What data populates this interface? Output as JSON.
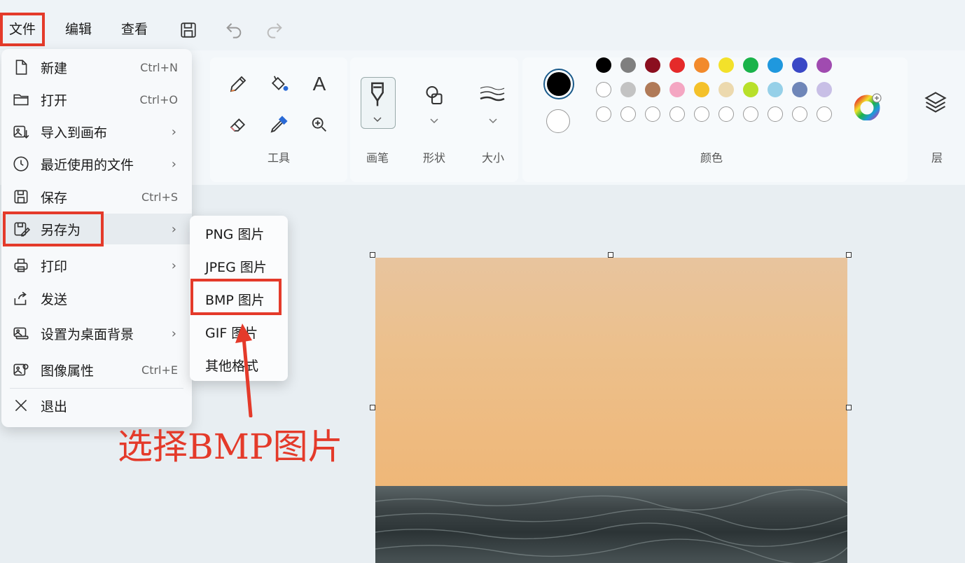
{
  "menubar": {
    "file": "文件",
    "edit": "编辑",
    "view": "查看"
  },
  "toolbar_icons": {
    "save": "save-icon",
    "undo": "undo-icon",
    "redo": "redo-icon"
  },
  "ribbon": {
    "tools_label": "工具",
    "brush_label": "画笔",
    "shape_label": "形状",
    "size_label": "大小",
    "color_label": "颜色",
    "layers_label": "层",
    "text_tool_glyph": "A",
    "primary_color": "#000000",
    "secondary_color": "#ffffff",
    "palette_row1": [
      "#000000",
      "#7f7f7f",
      "#8b0f1f",
      "#e52a2a",
      "#f28a2c",
      "#f3e12a",
      "#1ab34a",
      "#1f98de",
      "#3a48c6",
      "#a04bb0"
    ],
    "palette_row2": [
      "#ffffff",
      "#c3c3c3",
      "#b07a58",
      "#f4a6c2",
      "#f4c12a",
      "#ecd9ae",
      "#b8e02a",
      "#96d0e8",
      "#6f86b8",
      "#c8bfe6"
    ]
  },
  "file_menu": {
    "items": [
      {
        "label": "新建",
        "shortcut": "Ctrl+N",
        "icon": "new-file-icon"
      },
      {
        "label": "打开",
        "shortcut": "Ctrl+O",
        "icon": "folder-icon"
      },
      {
        "label": "导入到画布",
        "submenu": true,
        "icon": "import-image-icon"
      },
      {
        "label": "最近使用的文件",
        "submenu": true,
        "icon": "clock-icon"
      },
      {
        "label": "保存",
        "shortcut": "Ctrl+S",
        "icon": "save-icon"
      },
      {
        "label": "另存为",
        "submenu": true,
        "icon": "save-as-icon"
      },
      {
        "label": "打印",
        "submenu": true,
        "icon": "printer-icon"
      },
      {
        "label": "发送",
        "icon": "share-icon"
      },
      {
        "label": "设置为桌面背景",
        "submenu": true,
        "icon": "desktop-background-icon"
      },
      {
        "label": "图像属性",
        "shortcut": "Ctrl+E",
        "icon": "image-properties-icon"
      },
      {
        "label": "退出",
        "icon": "close-icon"
      }
    ]
  },
  "save_as_submenu": {
    "items": [
      "PNG 图片",
      "JPEG 图片",
      "BMP 图片",
      "GIF 图片",
      "其他格式"
    ]
  },
  "annotation": "选择BMP图片",
  "colors": {
    "highlight": "#e43a2a"
  }
}
